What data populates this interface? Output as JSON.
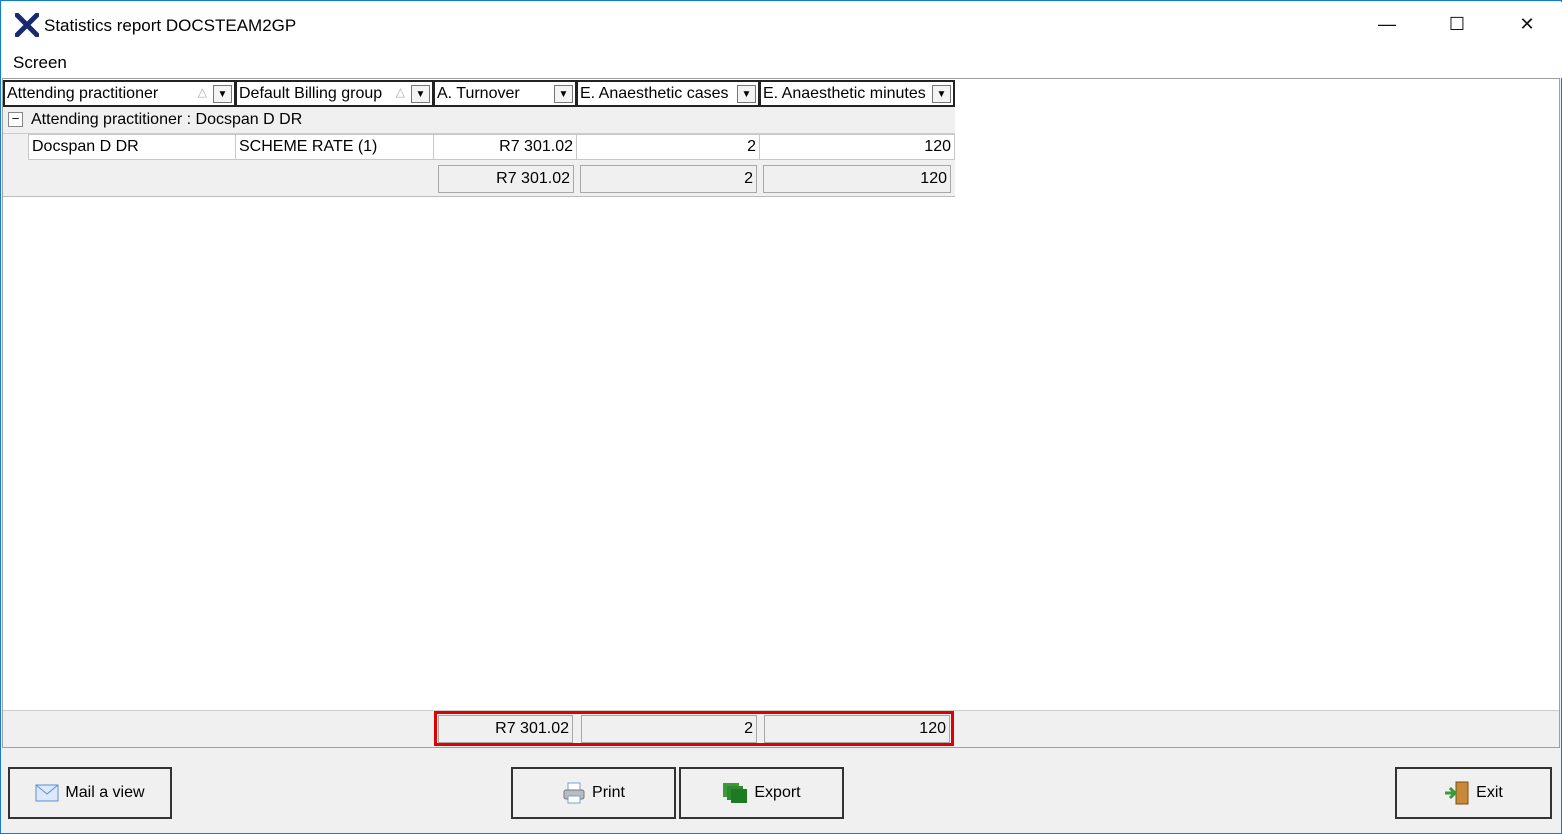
{
  "window": {
    "title": "Statistics report DOCSTEAM2GP",
    "minimize": "—",
    "maximize": "☐",
    "close": "✕"
  },
  "menu": {
    "screen": "Screen"
  },
  "columns": [
    {
      "label": "Attending practitioner"
    },
    {
      "label": "Default Billing group"
    },
    {
      "label": "A. Turnover"
    },
    {
      "label": "E. Anaesthetic cases"
    },
    {
      "label": "E. Anaesthetic minutes"
    }
  ],
  "group": {
    "label": "Attending practitioner : Docspan D  DR",
    "toggle": "−"
  },
  "row": {
    "practitioner": "Docspan D  DR",
    "billing_group": "SCHEME RATE (1)",
    "turnover": "R7 301.02",
    "cases": "2",
    "minutes": "120"
  },
  "group_summary": {
    "turnover": "R7 301.02",
    "cases": "2",
    "minutes": "120"
  },
  "grand_total": {
    "turnover": "R7 301.02",
    "cases": "2",
    "minutes": "120"
  },
  "buttons": {
    "mail": "Mail a view",
    "print": "Print",
    "export": "Export",
    "exit": "Exit"
  },
  "colors": {
    "highlight": "#e00000",
    "title_border": "#1979ca"
  }
}
